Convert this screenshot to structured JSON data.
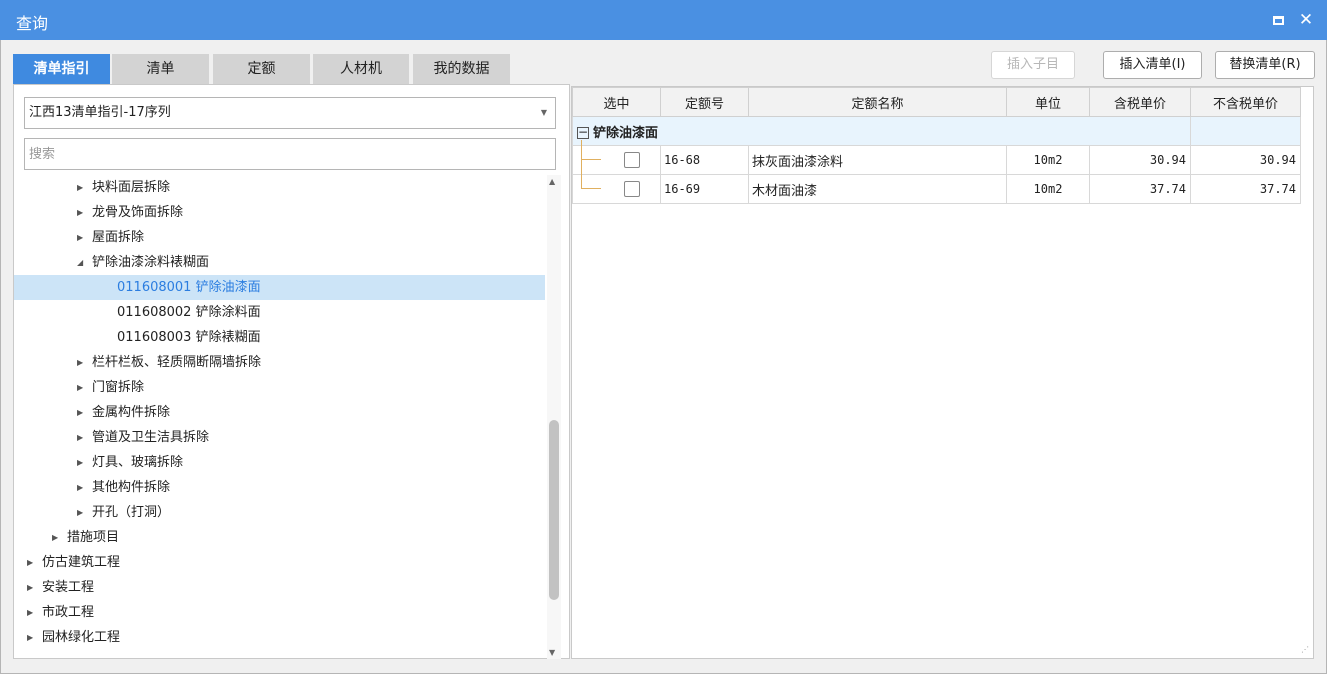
{
  "window": {
    "title": "查询"
  },
  "tabs": [
    {
      "label": "清单指引",
      "active": true
    },
    {
      "label": "清单",
      "active": false
    },
    {
      "label": "定额",
      "active": false
    },
    {
      "label": "人材机",
      "active": false
    },
    {
      "label": "我的数据",
      "active": false
    }
  ],
  "toolbar": {
    "insert_child": "插入子目",
    "insert_list": "插入清单(I)",
    "replace_list": "替换清单(R)"
  },
  "left": {
    "combo_value": "江西13清单指引-17序列",
    "search_placeholder": "搜索",
    "tree": [
      {
        "label": "块料面层拆除",
        "level": 2,
        "expander": "collapsed"
      },
      {
        "label": "龙骨及饰面拆除",
        "level": 2,
        "expander": "collapsed"
      },
      {
        "label": "屋面拆除",
        "level": 2,
        "expander": "collapsed"
      },
      {
        "label": "铲除油漆涂料裱糊面",
        "level": 2,
        "expander": "expanded"
      },
      {
        "label": "011608001  铲除油漆面",
        "level": 3,
        "expander": "none",
        "selected": true
      },
      {
        "label": "011608002  铲除涂料面",
        "level": 3,
        "expander": "none"
      },
      {
        "label": "011608003  铲除裱糊面",
        "level": 3,
        "expander": "none"
      },
      {
        "label": "栏杆栏板、轻质隔断隔墙拆除",
        "level": 2,
        "expander": "collapsed"
      },
      {
        "label": "门窗拆除",
        "level": 2,
        "expander": "collapsed"
      },
      {
        "label": "金属构件拆除",
        "level": 2,
        "expander": "collapsed"
      },
      {
        "label": "管道及卫生洁具拆除",
        "level": 2,
        "expander": "collapsed"
      },
      {
        "label": "灯具、玻璃拆除",
        "level": 2,
        "expander": "collapsed"
      },
      {
        "label": "其他构件拆除",
        "level": 2,
        "expander": "collapsed"
      },
      {
        "label": "开孔（打洞）",
        "level": 2,
        "expander": "collapsed"
      },
      {
        "label": "措施项目",
        "level": 1,
        "expander": "collapsed"
      },
      {
        "label": "仿古建筑工程",
        "level": 0,
        "expander": "collapsed"
      },
      {
        "label": "安装工程",
        "level": 0,
        "expander": "collapsed"
      },
      {
        "label": "市政工程",
        "level": 0,
        "expander": "collapsed"
      },
      {
        "label": "园林绿化工程",
        "level": 0,
        "expander": "collapsed"
      }
    ]
  },
  "grid": {
    "headers": [
      "选中",
      "定额号",
      "定额名称",
      "单位",
      "含税单价",
      "不含税单价"
    ],
    "group_label": "铲除油漆面",
    "rows": [
      {
        "code": "16-68",
        "name": "抹灰面油漆涂料",
        "unit": "10m2",
        "price_tax": "30.94",
        "price_notax": "30.94",
        "checked": false
      },
      {
        "code": "16-69",
        "name": "木材面油漆",
        "unit": "10m2",
        "price_tax": "37.74",
        "price_notax": "37.74",
        "checked": false
      }
    ]
  },
  "colors": {
    "titlebar": "#4a90e2",
    "active_tab": "#3f8ae0",
    "selected_row": "#cce4f7",
    "group_row": "#e8f4fd"
  }
}
